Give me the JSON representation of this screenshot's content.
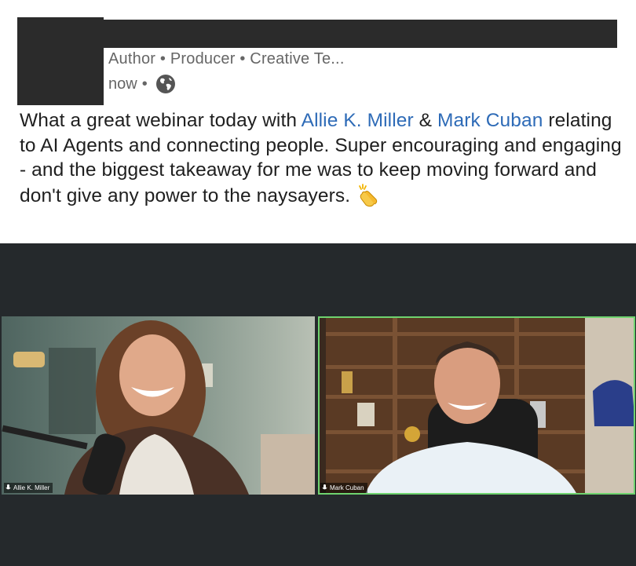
{
  "post": {
    "author_headline": "Author • Producer • Creative Te...",
    "timestamp": "now",
    "separator": "•",
    "visibility_icon": "globe-icon",
    "text_part1": "What a great webinar today with ",
    "mention1": "Allie K. Miller",
    "text_part2": " & ",
    "mention2": "Mark Cuban",
    "text_part3": " relating to AI Agents and connecting people. Super encouraging and engaging - and the biggest takeaway for me was to keep moving forward and don't give any power to the naysayers.",
    "emoji": "clapping-hands-icon"
  },
  "video_call": {
    "participants": [
      {
        "name": "Allie K. Miller",
        "mic_label": "Allie",
        "active_speaker": false
      },
      {
        "name": "Mark Cuban",
        "active_speaker": true
      }
    ]
  },
  "colors": {
    "mention": "#2e6bb7",
    "video_background": "#25292c",
    "active_speaker_border": "#6fd36f",
    "redaction": "#2b2b2b"
  }
}
